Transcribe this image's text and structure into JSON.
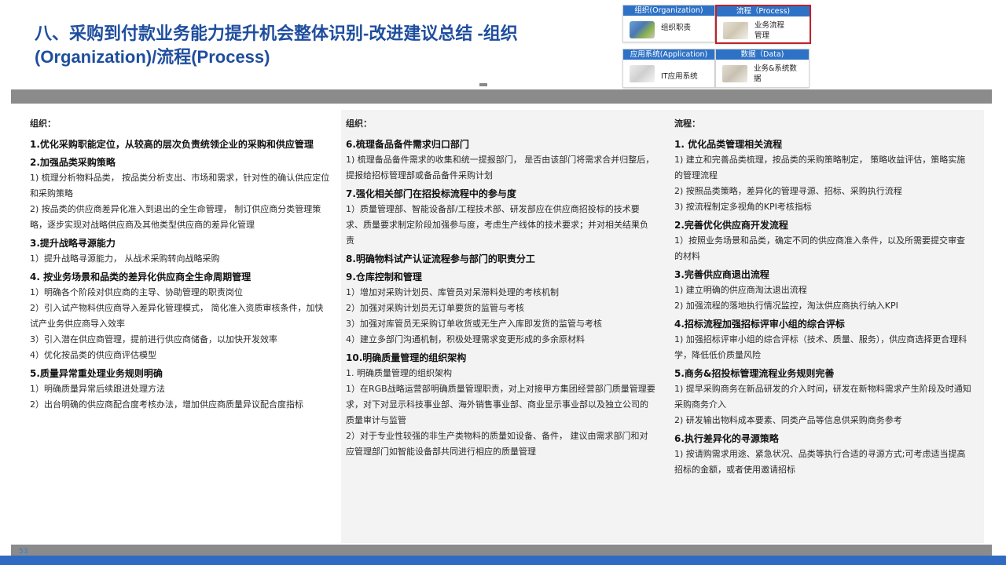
{
  "title": {
    "line1": "八、采购到付款业务能力提升机会整体识别-改进建议总结 -组织",
    "line2": "(Organization)/流程(Process)"
  },
  "legend": {
    "org_header": "组织(Organization)",
    "org_label": "组织职责",
    "process_header": "流程（Process)",
    "process_label": "业务流程管理",
    "app_header": "应用系统(Application)",
    "app_label": "IT应用系统",
    "data_header": "数据（Data)",
    "data_label": "业务&系统数据"
  },
  "page_number": "53",
  "col1": {
    "header": "组织：",
    "items": [
      {
        "type": "h",
        "text": "1.优化采购职能定位，从较高的层次负责统领企业的采购和供应管理"
      },
      {
        "type": "h",
        "text": "2.加强品类采购策略"
      },
      {
        "type": "t",
        "text": "1)   梳理分析物料品类，  按品类分析支出、市场和需求，针对性的确认供应定位和采购策略"
      },
      {
        "type": "t",
        "text": "2)   按品类的供应商差异化准入到退出的全生命管理，  制订供应商分类管理策略，逐步实现对战略供应商及其他类型供应商的差异化管理"
      },
      {
        "type": "h",
        "text": "3.提升战略寻源能力"
      },
      {
        "type": "t",
        "text": "1）提升战略寻源能力，  从战术采购转向战略采购"
      },
      {
        "type": "h",
        "text": "4. 按业务场景和品类的差异化供应商全生命周期管理"
      },
      {
        "type": "t",
        "text": "1）明确各个阶段对供应商的主导、协助管理的职责岗位"
      },
      {
        "type": "t",
        "text": "2）引入试产物料供应商导入差异化管理模式，  简化准入资质审核条件，加快试产业务供应商导入效率"
      },
      {
        "type": "t",
        "text": "3）引入潜在供应商管理，提前进行供应商储备，以加快开发效率"
      },
      {
        "type": "t",
        "text": "4）优化按品类的供应商评估模型"
      },
      {
        "type": "h",
        "text": "5.质量异常重处理业务规则明确"
      },
      {
        "type": "t",
        "text": "1）明确质量异常后续跟进处理方法"
      },
      {
        "type": "t",
        "text": "2）出台明确的供应商配合度考核办法，增加供应商质量异议配合度指标"
      }
    ]
  },
  "col2": {
    "header": "组织：",
    "items": [
      {
        "type": "h",
        "text": "6.梳理备品备件需求归口部门"
      },
      {
        "type": "t",
        "text": "1)   梳理备品备件需求的收集和统一提报部门，   是否由该部门将需求合并归整后，提报给招标管理部或备品备件采购计划"
      },
      {
        "type": "h",
        "text": "7.强化相关部门在招投标流程中的参与度"
      },
      {
        "type": "t",
        "text": "1）质量管理部、智能设备部/工程技术部、研发部应在供应商招投标的技术要求、质量要求制定阶段加强参与度，考虑生产线体的技术要求；并对相关结果负责"
      },
      {
        "type": "h",
        "text": "8.明确物料试产认证流程参与部门的职责分工"
      },
      {
        "type": "h",
        "text": "9.仓库控制和管理"
      },
      {
        "type": "t",
        "text": "1）增加对采购计划员、库管员对呆滞料处理的考核机制"
      },
      {
        "type": "t",
        "text": "2）加强对采购计划员无订单要货的监管与考核"
      },
      {
        "type": "t",
        "text": "3）加强对库管员无采购订单收货或无生产入库即发货的监管与考核"
      },
      {
        "type": "t",
        "text": "4）建立多部门沟通机制，积极处理需求变更形成的多余原材料"
      },
      {
        "type": "h",
        "text": "10.明确质量管理的组织架构"
      },
      {
        "type": "t",
        "text": "1. 明确质量管理的组织架构"
      },
      {
        "type": "t",
        "text": "  1）在RGB战略运营部明确质量管理职责，对上对接甲方集团经营部门质量管理要求，对下对显示科技事业部、海外销售事业部、商业显示事业部以及独立公司的质量审计与监管"
      },
      {
        "type": "t",
        "text": "2）对于专业性较强的非生产类物料的质量如设备、备件，   建议由需求部门和对应管理部门如智能设备部共同进行相应的质量管理"
      }
    ]
  },
  "col3": {
    "header": "流程：",
    "items": [
      {
        "type": "h",
        "text": "1. 优化品类管理相关流程"
      },
      {
        "type": "t",
        "text": "1)    建立和完善品类梳理，按品类的采购策略制定，  策略收益评估，策略实施的管理流程"
      },
      {
        "type": "t",
        "text": "2)    按照品类策略，差异化的管理寻源、招标、采购执行流程"
      },
      {
        "type": "t",
        "text": "3)    按流程制定多视角的KPI考核指标"
      },
      {
        "type": "h",
        "text": "2.完善优化供应商开发流程"
      },
      {
        "type": "t",
        "text": "1）按照业务场景和品类，确定不同的供应商准入条件，以及所需要提交审查的材料"
      },
      {
        "type": "h",
        "text": "3.完善供应商退出流程"
      },
      {
        "type": "t",
        "text": "1)    建立明确的供应商淘汰退出流程"
      },
      {
        "type": "t",
        "text": "2)    加强流程的落地执行情况监控，淘汰供应商执行纳入KPI"
      },
      {
        "type": "h",
        "text": "4.招标流程加强招标评审小组的综合评标"
      },
      {
        "type": "t",
        "text": "1)    加强招标评审小组的综合评标（技术、质量、服务），供应商选择更合理科学，降低低价质量风险"
      },
      {
        "type": "h",
        "text": "5.商务&招投标管理流程业务规则完善"
      },
      {
        "type": "t",
        "text": "1)    提早采购商务在新品研发的介入时间，研发在新物料需求产生阶段及时通知采购商务介入"
      },
      {
        "type": "t",
        "text": "2)    研发输出物料成本要素、同类产品等信息供采购商务参考"
      },
      {
        "type": "h",
        "text": "6.执行差异化的寻源策略"
      },
      {
        "type": "t",
        "text": "1)    按请购需求用途、紧急状况、品类等执行合适的寻源方式;可考虑适当提高招标的金额，或者使用邀请招标"
      }
    ]
  }
}
